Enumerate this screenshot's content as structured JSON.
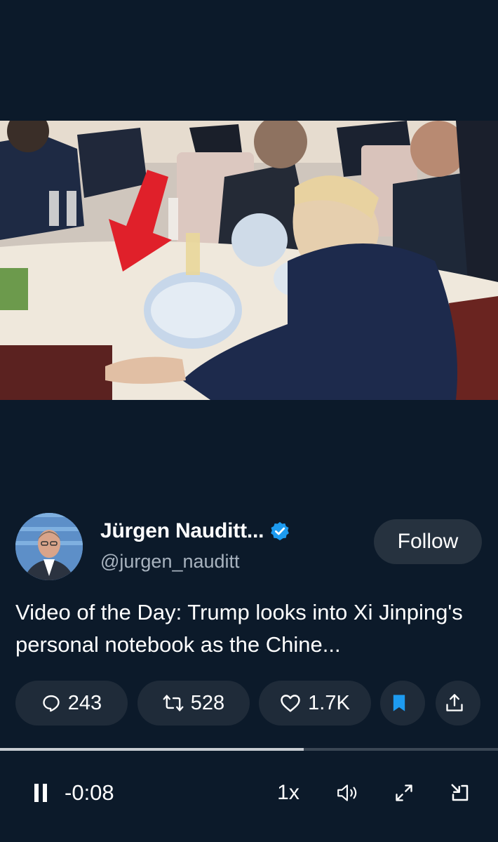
{
  "author": {
    "name": "Jürgen Nauditt...",
    "handle": "@jurgen_nauditt",
    "verified": true
  },
  "follow_label": "Follow",
  "caption": "Video of the Day: Trump looks into Xi Jinping's personal notebook as the Chine...",
  "actions": {
    "replies": "243",
    "reposts": "528",
    "likes": "1.7K",
    "bookmarked": true
  },
  "player": {
    "time_remaining": "-0:08",
    "speed": "1x",
    "progress": 0.61
  },
  "colors": {
    "background": "#0c1a2a",
    "pill": "#1f2b39",
    "bookmark_accent": "#1d9bf0",
    "verified": "#1d9bf0",
    "arrow": "#e0202a"
  },
  "icons": [
    "reply-icon",
    "repost-icon",
    "like-icon",
    "bookmark-icon",
    "share-icon",
    "pause-icon",
    "volume-icon",
    "fullscreen-icon",
    "minimize-icon",
    "verified-icon",
    "red-arrow-overlay"
  ]
}
